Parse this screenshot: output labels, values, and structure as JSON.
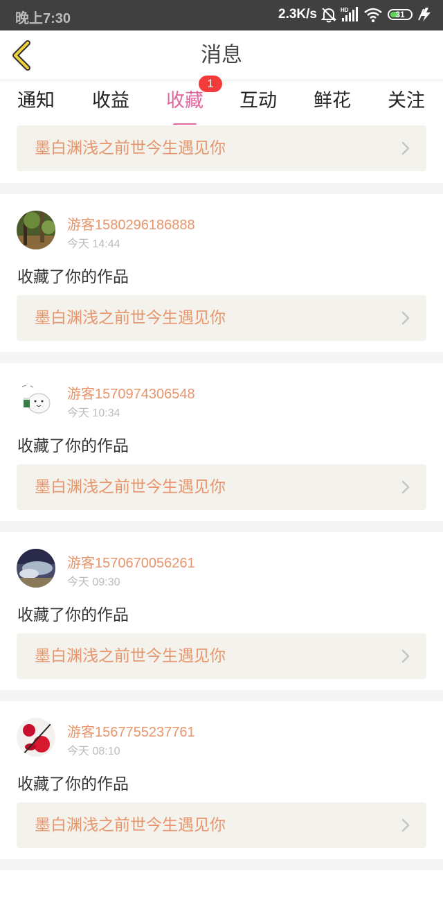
{
  "status_bar": {
    "time": "晚上7:30",
    "net_speed": "2.3K/s",
    "battery": "31",
    "icons": [
      "bell-off-icon",
      "hd-signal-icon",
      "wifi-icon",
      "battery-icon",
      "charging-icon"
    ]
  },
  "header": {
    "title": "消息",
    "back_icon": "chevron-left-icon",
    "accent_color": "#e3679f"
  },
  "tabs": [
    {
      "label": "通知"
    },
    {
      "label": "收益"
    },
    {
      "label": "收藏",
      "active": true,
      "badge": "1"
    },
    {
      "label": "互动"
    },
    {
      "label": "鲜花"
    },
    {
      "label": "关注"
    }
  ],
  "first_card": {
    "work_title": "墨白渊浅之前世今生遇见你"
  },
  "messages": [
    {
      "user": "游客1580296186888",
      "time": "今天 14:44",
      "action": "收藏了你的作品",
      "work_title": "墨白渊浅之前世今生遇见你"
    },
    {
      "user": "游客1570974306548",
      "time": "今天 10:34",
      "action": "收藏了你的作品",
      "work_title": "墨白渊浅之前世今生遇见你"
    },
    {
      "user": "游客1570670056261",
      "time": "今天 09:30",
      "action": "收藏了你的作品",
      "work_title": "墨白渊浅之前世今生遇见你"
    },
    {
      "user": "游客1567755237761",
      "time": "今天 08:10",
      "action": "收藏了你的作品",
      "work_title": "墨白渊浅之前世今生遇见你"
    }
  ]
}
